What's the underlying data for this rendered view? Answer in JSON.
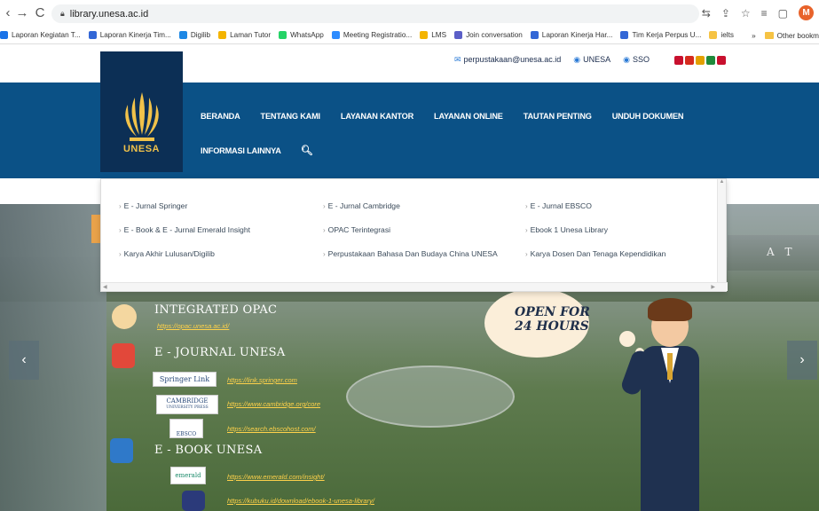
{
  "browser": {
    "url": "library.unesa.ac.id",
    "profile_initial": "M",
    "bookmarks": [
      {
        "label": "Laporan Kegiatan T...",
        "color": "#1a73e8"
      },
      {
        "label": "Laporan Kinerja Tim...",
        "color": "#3367d6"
      },
      {
        "label": "Digilib",
        "color": "#1e88e5"
      },
      {
        "label": "Laman Tutor",
        "color": "#f4b400"
      },
      {
        "label": "WhatsApp",
        "color": "#25d366"
      },
      {
        "label": "Meeting Registratio...",
        "color": "#2d8cff"
      },
      {
        "label": "LMS",
        "color": "#f4b400"
      },
      {
        "label": "Join conversation",
        "color": "#5b5fc7"
      },
      {
        "label": "Laporan Kinerja Har...",
        "color": "#3367d6"
      },
      {
        "label": "Tim Kerja Perpus U...",
        "color": "#3367d6"
      },
      {
        "label": "ielts",
        "color": "#f6c344"
      }
    ],
    "bookmarks_more": "»",
    "other_bookmarks": "Other bookm"
  },
  "site": {
    "top_links": {
      "email": "perpustakaan@unesa.ac.id",
      "unesa": "UNESA",
      "sso": "SSO"
    },
    "flag_colors": [
      "#c8102e",
      "#d52b1e",
      "#e3a000",
      "#1f8a3b",
      "#c8102e"
    ],
    "logo_text": "UNESA",
    "menu_row1": [
      "BERANDA",
      "TENTANG KAMI",
      "LAYANAN KANTOR",
      "LAYANAN ONLINE",
      "TAUTAN PENTING",
      "UNDUH DOKUMEN"
    ],
    "menu_row2": [
      "INFORMASI LAINNYA"
    ],
    "dropdown": {
      "col1": [
        "E - Jurnal Springer",
        "E - Book & E - Jurnal Emerald Insight",
        "Karya Akhir Lulusan/Digilib"
      ],
      "col2": [
        "E - Jurnal Cambridge",
        "OPAC Terintegrasi",
        "Perpustakaan Bahasa Dan Budaya China UNESA"
      ],
      "col3": [
        "E - Jurnal EBSCO",
        "Ebook 1 Unesa Library",
        "Karya Dosen Dan Tenaga Kependidikan"
      ]
    },
    "hero": {
      "opac_title": "INTEGRATED OPAC",
      "opac_link": "https://opac.unesa.ac.id/",
      "ejournal_title": "E - JOURNAL UNESA",
      "springer_label": "Springer Link",
      "springer_link": "https://link.springer.com",
      "cambridge_label": "CAMBRIDGE",
      "cambridge_sub": "UNIVERSITY PRESS",
      "cambridge_link": "https://www.cambridge.org/core",
      "ebsco_label": "EBSCO",
      "ebsco_link": "https://search.ebscohost.com/",
      "ebook_title": "E - BOOK UNESA",
      "emerald_label": "emerald",
      "emerald_link": "https://www.emerald.com/insight/",
      "kubuku_link": "https://kubuku.id/download/ebook-1-unesa-library/",
      "bubble_line1": "OPEN FOR",
      "bubble_line2": "24 HOURS",
      "wall_text": "A T"
    }
  }
}
